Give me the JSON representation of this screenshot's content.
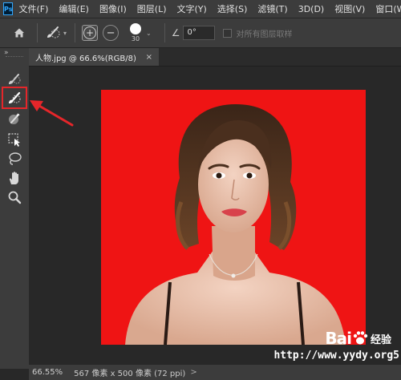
{
  "app": {
    "logo_text": "Ps"
  },
  "menu": {
    "items": [
      "文件(F)",
      "编辑(E)",
      "图像(I)",
      "图层(L)",
      "文字(Y)",
      "选择(S)",
      "滤镜(T)",
      "3D(D)",
      "视图(V)",
      "窗口(W)"
    ]
  },
  "options": {
    "home_icon": "home-icon",
    "tool_preset_icon": "quick-selection-brush-icon",
    "add_mode_symbol": "+",
    "subtract_mode_symbol": "−",
    "brush_size": "30",
    "angle_symbol": "∠",
    "angle_value": "0°",
    "sample_all_layers_label": "对所有图层取样"
  },
  "document": {
    "tab_label": "人物.jpg @ 66.6%(RGB/8)",
    "tab_close": "×"
  },
  "toolbar": {
    "collapse_label": "»",
    "tools": [
      "object-selection-icon",
      "quick-selection-icon",
      "magic-wand-icon",
      "crop-select-icon",
      "lasso-icon",
      "hand-icon",
      "zoom-icon"
    ],
    "highlighted_tool": "quick-selection-icon"
  },
  "status": {
    "zoom": "66.55%",
    "doc_info": "567 像素 x 500 像素 (72 ppi)",
    "arrow": ">"
  },
  "watermark": {
    "brand": "Bai",
    "brand_suffix": "经验",
    "url": "http://www.yydy.org5"
  },
  "colors": {
    "canvas_background": "#ef1414",
    "annotation": "#e5262a",
    "ps_accent": "#31a8ff"
  }
}
